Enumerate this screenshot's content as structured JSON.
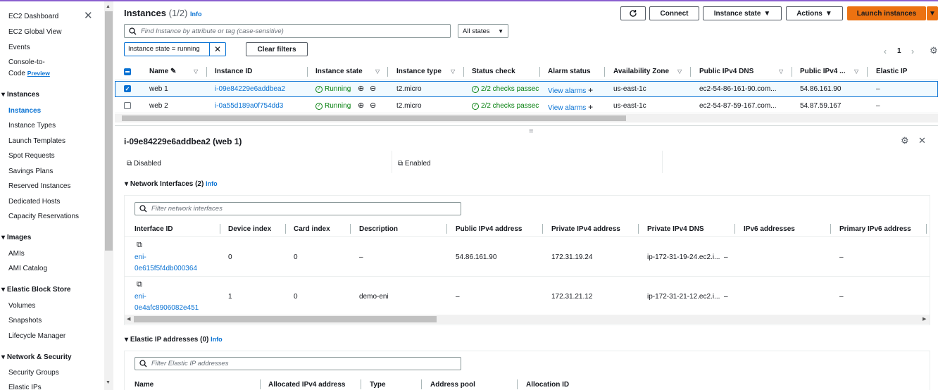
{
  "sidebar": {
    "dashboard": "EC2 Dashboard",
    "global_view": "EC2 Global View",
    "events": "Events",
    "console_line1": "Console-to-",
    "console_line2": "Code",
    "preview": "Preview",
    "instances_header": "Instances",
    "instances_items": [
      "Instances",
      "Instance Types",
      "Launch Templates",
      "Spot Requests",
      "Savings Plans",
      "Reserved Instances",
      "Dedicated Hosts",
      "Capacity Reservations"
    ],
    "images_header": "Images",
    "images_items": [
      "AMIs",
      "AMI Catalog"
    ],
    "ebs_header": "Elastic Block Store",
    "ebs_items": [
      "Volumes",
      "Snapshots",
      "Lifecycle Manager"
    ],
    "network_header": "Network & Security",
    "network_items": [
      "Security Groups",
      "Elastic IPs"
    ]
  },
  "header": {
    "title": "Instances",
    "count": "(1/2)",
    "info": "Info",
    "connect": "Connect",
    "instance_state": "Instance state",
    "actions": "Actions",
    "launch": "Launch instances"
  },
  "search": {
    "placeholder": "Find Instance by attribute or tag (case-sensitive)",
    "states": "All states",
    "filter_token": "Instance state = running",
    "clear": "Clear filters",
    "page": "1"
  },
  "table": {
    "columns": [
      "Name",
      "Instance ID",
      "Instance state",
      "Instance type",
      "Status check",
      "Alarm status",
      "Availability Zone",
      "Public IPv4 DNS",
      "Public IPv4 ...",
      "Elastic IP"
    ],
    "rows": [
      {
        "name": "web 1",
        "id": "i-09e84229e6addbea2",
        "state": "Running",
        "type": "t2.micro",
        "status": "2/2 checks passec",
        "alarm": "View alarms",
        "az": "us-east-1c",
        "dns": "ec2-54-86-161-90.com...",
        "ip": "54.86.161.90",
        "eip": "–"
      },
      {
        "name": "web 2",
        "id": "i-0a55d189a0f754dd3",
        "state": "Running",
        "type": "t2.micro",
        "status": "2/2 checks passec",
        "alarm": "View alarms",
        "az": "us-east-1c",
        "dns": "ec2-54-87-59-167.com...",
        "ip": "54.87.59.167",
        "eip": "–"
      }
    ]
  },
  "detail": {
    "title": "i-09e84229e6addbea2 (web 1)",
    "disabled": "Disabled",
    "enabled": "Enabled",
    "ni_header": "Network Interfaces (2)",
    "info": "Info",
    "ni_filter": "Filter network interfaces",
    "ni_columns": [
      "Interface ID",
      "Device index",
      "Card index",
      "Description",
      "Public IPv4 address",
      "Private IPv4 address",
      "Private IPv4 DNS",
      "IPv6 addresses",
      "Primary IPv6 address"
    ],
    "ni_rows": [
      {
        "id1": "eni-",
        "id2": "0e615f5f4db000364",
        "dev": "0",
        "card": "0",
        "desc": "–",
        "pub": "54.86.161.90",
        "priv": "172.31.19.24",
        "dns": "ip-172-31-19-24.ec2.i...",
        "v6": "–",
        "pv6": "–"
      },
      {
        "id1": "eni-",
        "id2": "0e4afc8906082e451",
        "dev": "1",
        "card": "0",
        "desc": "demo-eni",
        "pub": "–",
        "priv": "172.31.21.12",
        "dns": "ip-172-31-21-12.ec2.i...",
        "v6": "–",
        "pv6": "–"
      }
    ],
    "eip_header": "Elastic IP addresses (0)",
    "eip_filter": "Filter Elastic IP addresses",
    "eip_columns": [
      "Name",
      "Allocated IPv4 address",
      "Type",
      "Address pool",
      "Allocation ID"
    ]
  }
}
